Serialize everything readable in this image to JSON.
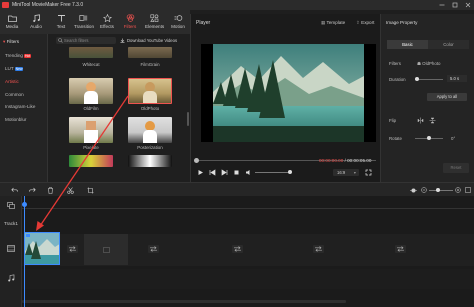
{
  "app": {
    "title": "MiniTool MovieMaker Free 7.3.0"
  },
  "toolbar": {
    "items": [
      {
        "label": "Media"
      },
      {
        "label": "Audio"
      },
      {
        "label": "Text"
      },
      {
        "label": "Transition"
      },
      {
        "label": "Effects"
      },
      {
        "label": "Filters"
      },
      {
        "label": "Elements"
      },
      {
        "label": "Motion"
      }
    ]
  },
  "library": {
    "section": "Filters",
    "categories": [
      {
        "label": "Trending",
        "badge": "Hot"
      },
      {
        "label": "LUT",
        "badge": "New"
      },
      {
        "label": "Artistic"
      },
      {
        "label": "Common"
      },
      {
        "label": "Instagram-Like"
      },
      {
        "label": "Motionblur"
      }
    ],
    "search_placeholder": "Search filters",
    "download_label": "Download YouTube Videos",
    "filters": [
      {
        "label": "Whitecat"
      },
      {
        "label": "FilmGrain"
      },
      {
        "label": "OldFilm"
      },
      {
        "label": "OldPhoto"
      },
      {
        "label": "Pixelate"
      },
      {
        "label": "Posterization"
      }
    ]
  },
  "player": {
    "label": "Player",
    "template_label": "Template",
    "export_label": "Export",
    "timecode_current": "00:00:00.00",
    "timecode_separator": "/",
    "timecode_total": "00:00:05.00",
    "aspect_ratio": "16:9"
  },
  "properties": {
    "title": "Image Property",
    "tabs": [
      {
        "label": "Basic"
      },
      {
        "label": "Color"
      }
    ],
    "filters_label": "Filters",
    "filter_value": "OldPhoto",
    "duration_label": "Duration",
    "duration_value": "5.0 s",
    "apply_all": "Apply to all",
    "flip_label": "Flip",
    "rotate_label": "Rotate",
    "rotate_value": "0°",
    "reset_label": "Reset"
  },
  "timeline": {
    "track_label": "Track1"
  },
  "colors": {
    "accent": "#ef5350",
    "background": "#1e1e1e",
    "panel": "#242424"
  }
}
